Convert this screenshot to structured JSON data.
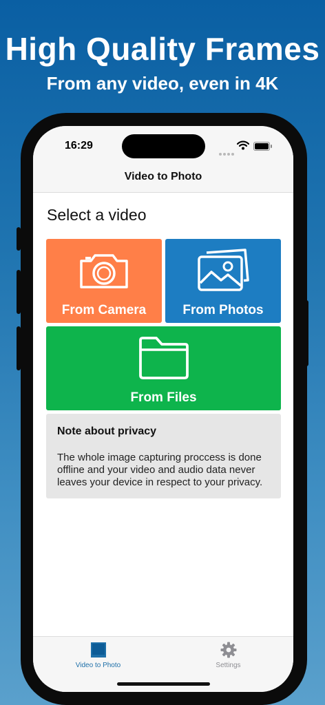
{
  "promo": {
    "headline": "High Quality Frames",
    "subline": "From any video, even in 4K"
  },
  "status_bar": {
    "time": "16:29"
  },
  "nav": {
    "title": "Video to Photo"
  },
  "main": {
    "section_title": "Select a video",
    "tiles": {
      "camera": {
        "label": "From Camera",
        "icon": "camera-icon",
        "color": "#ff7f48"
      },
      "photos": {
        "label": "From Photos",
        "icon": "photos-icon",
        "color": "#1d7dc2"
      },
      "files": {
        "label": "From Files",
        "icon": "folder-icon",
        "color": "#0eb44c"
      }
    },
    "privacy": {
      "title": "Note about privacy",
      "body": "The whole image capturing proccess is done offline and your video and audio data never leaves your device in respect to your privacy."
    }
  },
  "tab_bar": {
    "items": [
      {
        "label": "Video to Photo",
        "icon": "photo-frame-icon",
        "active": true,
        "color": "#1d6fa8"
      },
      {
        "label": "Settings",
        "icon": "gear-icon",
        "active": false,
        "color": "#8e8e93"
      }
    ]
  }
}
